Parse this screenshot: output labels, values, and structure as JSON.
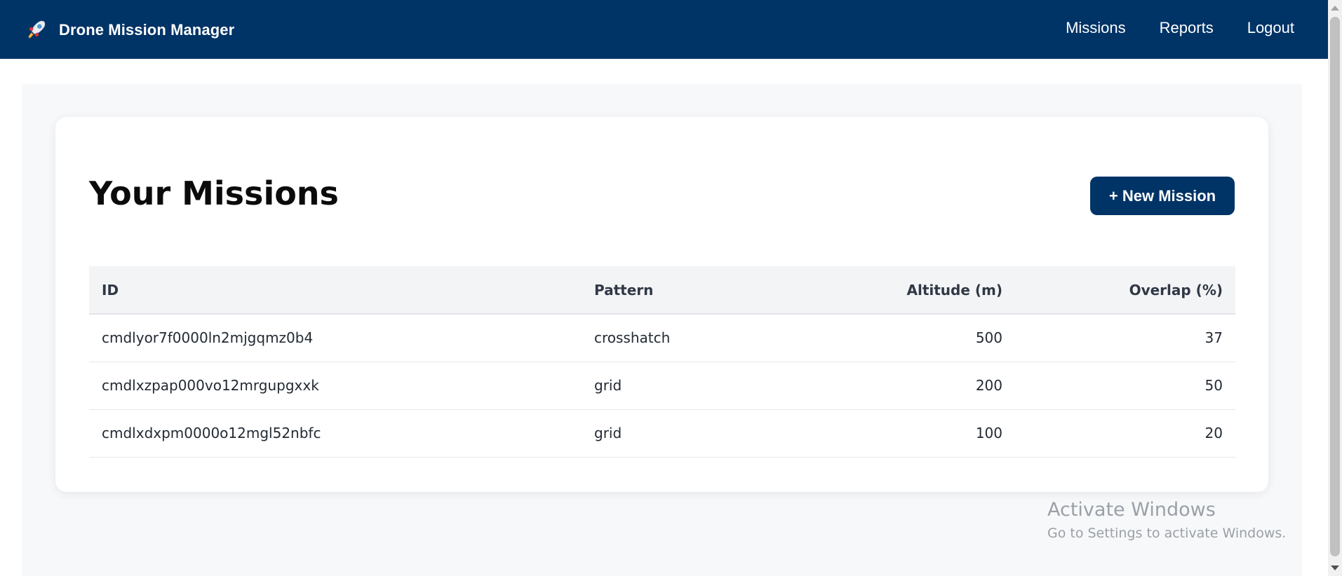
{
  "header": {
    "brand_icon": "rocket-icon",
    "title": "Drone Mission Manager",
    "nav": [
      "Missions",
      "Reports",
      "Logout"
    ],
    "background": "#003366"
  },
  "main": {
    "title": "Your Missions",
    "new_mission_label": "+ New Mission",
    "accent": "#003366",
    "table": {
      "columns": [
        "ID",
        "Pattern",
        "Altitude (m)",
        "Overlap (%)"
      ],
      "rows": [
        {
          "id": "cmdlyor7f0000ln2mjgqmz0b4",
          "pattern": "crosshatch",
          "altitude": "500",
          "overlap": "37"
        },
        {
          "id": "cmdlxzpap000vo12mrgupgxxk",
          "pattern": "grid",
          "altitude": "200",
          "overlap": "50"
        },
        {
          "id": "cmdlxdxpm0000o12mgl52nbfc",
          "pattern": "grid",
          "altitude": "100",
          "overlap": "20"
        }
      ]
    }
  },
  "watermark": {
    "title": "Activate Windows",
    "subtitle": "Go to Settings to activate Windows."
  }
}
